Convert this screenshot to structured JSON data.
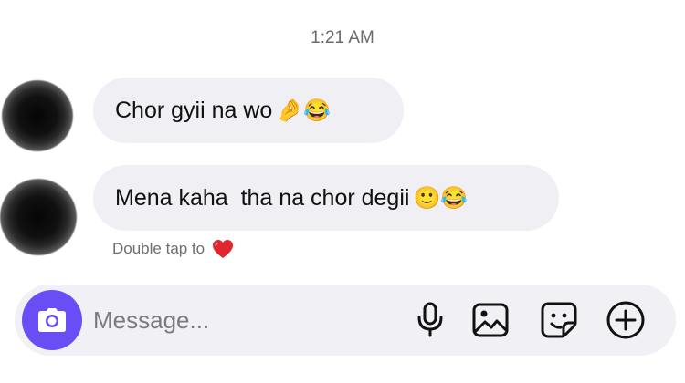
{
  "header": {
    "timestamp": "1:21 AM"
  },
  "messages": [
    {
      "text": "Chor gyii na wo",
      "emojis": "🤌😂"
    },
    {
      "text": "Mena kaha  tha na chor degii",
      "emojis": "🙂😂"
    }
  ],
  "reaction_hint": {
    "label": "Double tap to",
    "icon": "heart-icon",
    "color": "#e0262f"
  },
  "composer": {
    "placeholder": "Message...",
    "camera_color": "#6a4ef5",
    "icons": [
      "camera-icon",
      "microphone-icon",
      "image-icon",
      "sticker-icon",
      "plus-circle-icon"
    ]
  }
}
